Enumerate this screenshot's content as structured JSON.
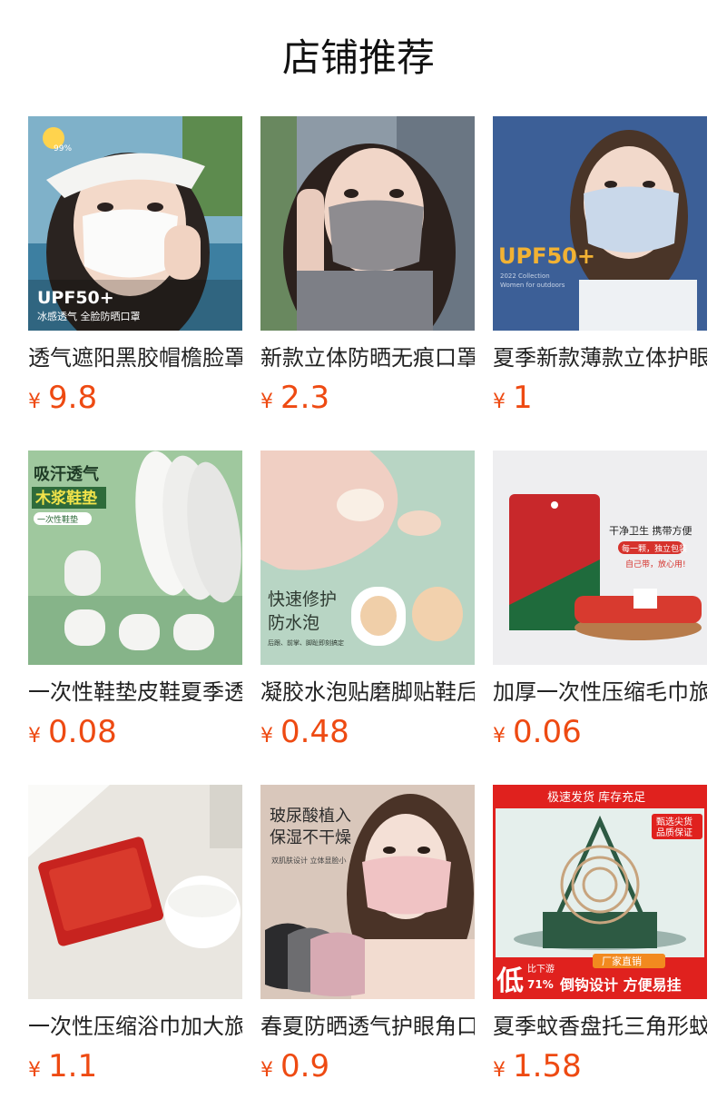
{
  "page": {
    "title": "店铺推荐"
  },
  "products": [
    {
      "name": "透气遮阳黑胶帽檐脸罩",
      "currency": "¥",
      "price": "9.8",
      "image_text": [
        "UPF50+",
        "冰感透气 全脸防晒口罩",
        "99%"
      ]
    },
    {
      "name": "新款立体防晒无痕口罩",
      "currency": "¥",
      "price": "2.3",
      "image_text": []
    },
    {
      "name": "夏季新款薄款立体护眼",
      "currency": "¥",
      "price": "1",
      "image_text": [
        "UPF50+",
        "2022 Collection",
        "Women for outdoors"
      ]
    },
    {
      "name": "一次性鞋垫皮鞋夏季透",
      "currency": "¥",
      "price": "0.08",
      "image_text": [
        "吸汗透气",
        "木浆鞋垫",
        "一次性鞋垫"
      ]
    },
    {
      "name": "凝胶水泡贴磨脚贴鞋后",
      "currency": "¥",
      "price": "0.48",
      "image_text": [
        "快速修护",
        "防水泡",
        "后跟、前掌、脚趾即刻搞定"
      ]
    },
    {
      "name": "加厚一次性压缩毛巾旅",
      "currency": "¥",
      "price": "0.06",
      "image_text": [
        "干净卫生 携带方便",
        "每一颗，独立包装",
        "自己带，放心用!"
      ]
    },
    {
      "name": "一次性压缩浴巾加大旅",
      "currency": "¥",
      "price": "1.1",
      "image_text": []
    },
    {
      "name": "春夏防晒透气护眼角口",
      "currency": "¥",
      "price": "0.9",
      "image_text": [
        "玻尿酸植入",
        "保湿不干燥",
        "双肌肤设计 立体显脸小"
      ]
    },
    {
      "name": "夏季蚊香盘托三角形蚊",
      "currency": "¥",
      "price": "1.58",
      "image_text": [
        "极速发货 库存充足",
        "甄选尖货",
        "品质保证",
        "低",
        "比下游",
        "71%",
        "厂家直销",
        "倒钩设计 方便易挂"
      ]
    }
  ]
}
